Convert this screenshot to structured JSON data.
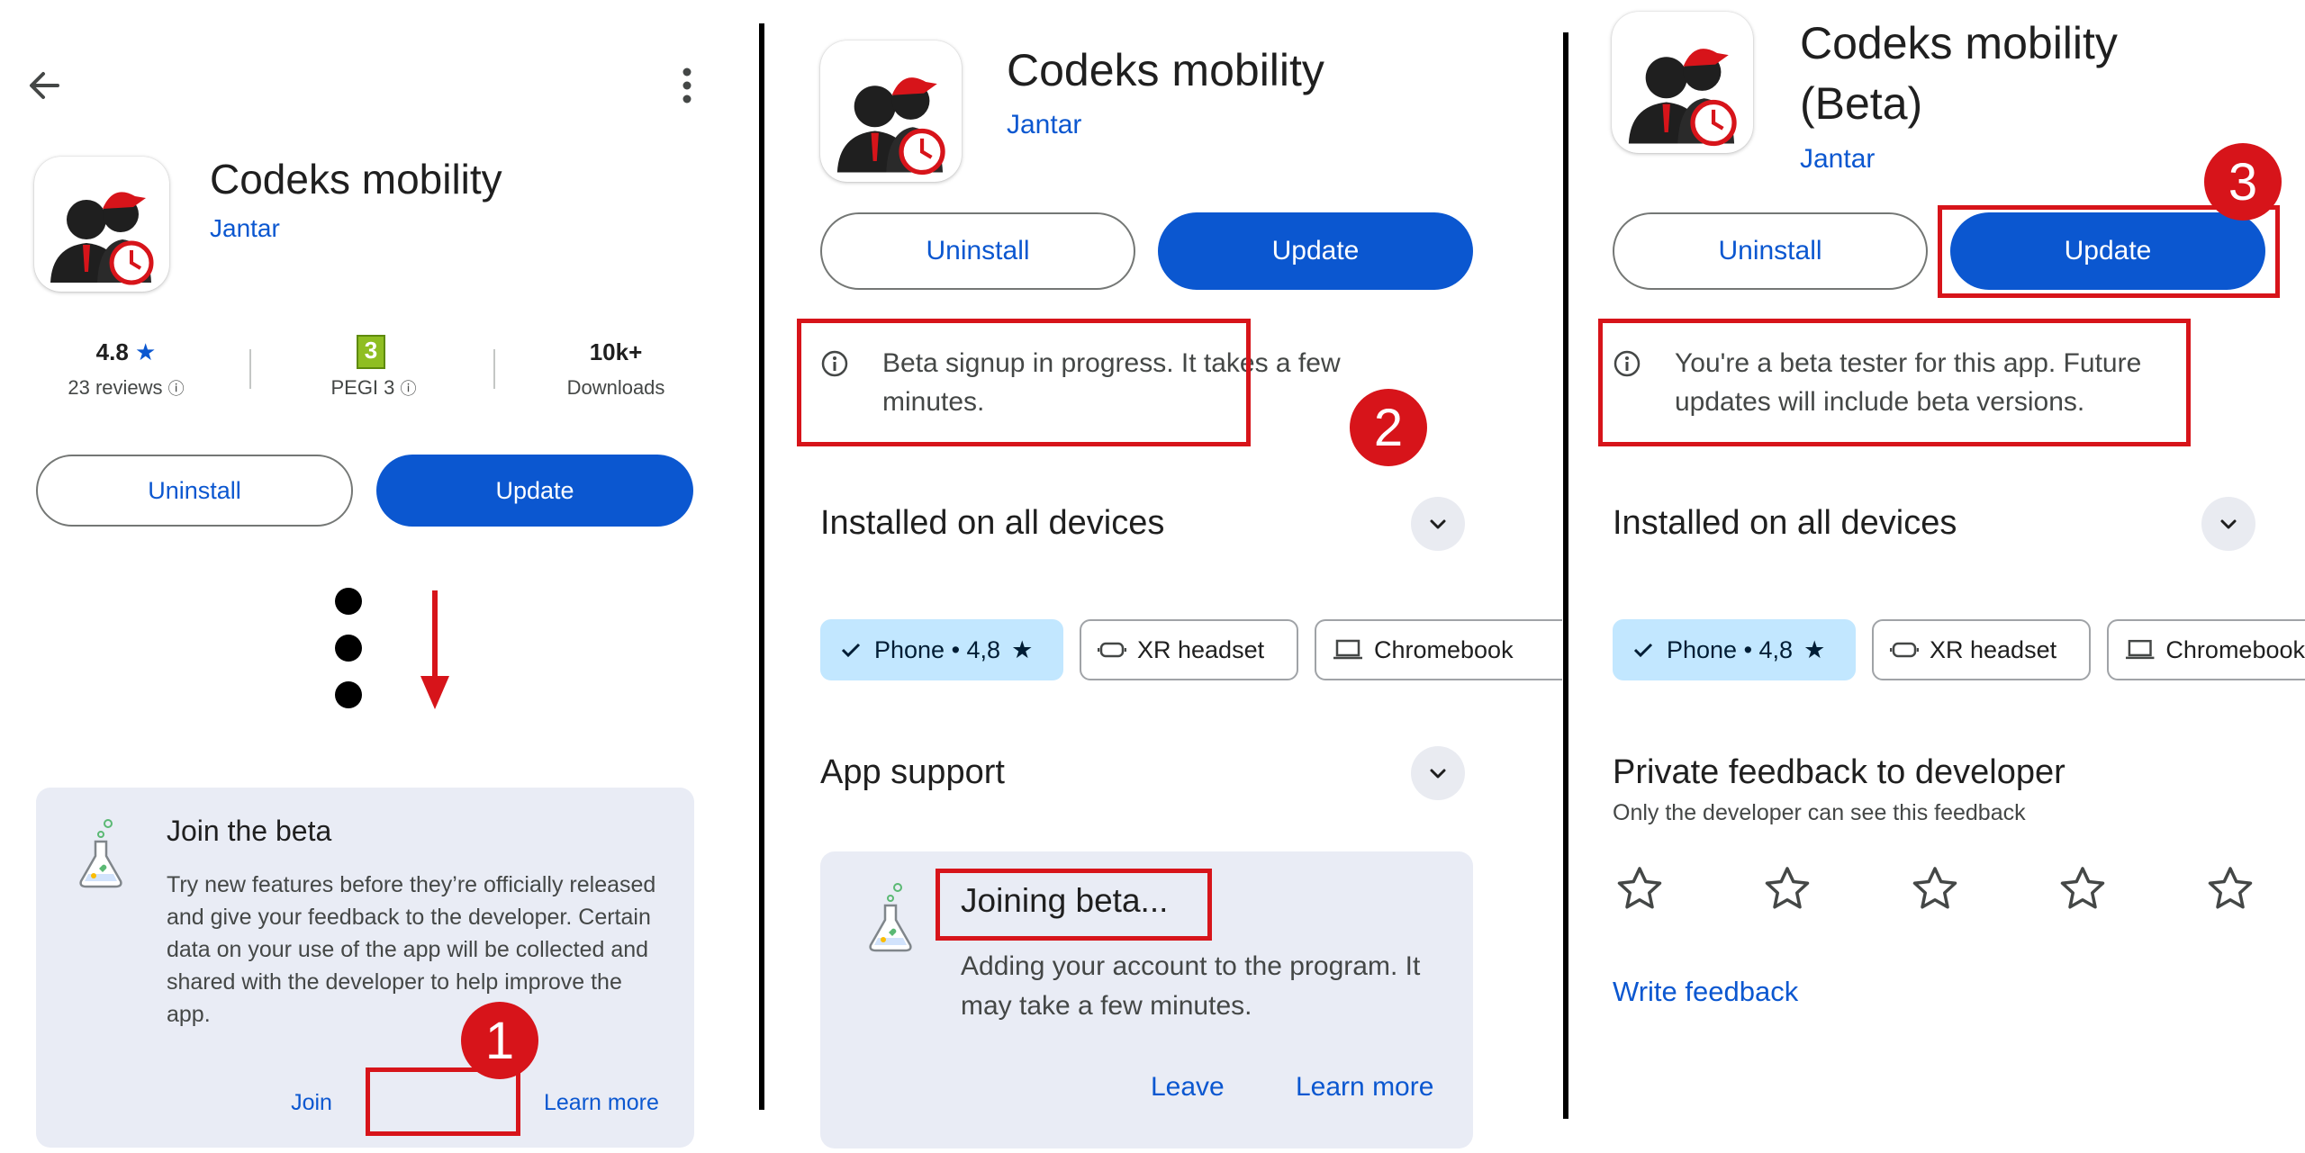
{
  "app": {
    "name": "Codeks mobility",
    "name_beta_line1": "Codeks mobility",
    "name_beta_line2": "(Beta)",
    "developer": "Jantar"
  },
  "meta": {
    "rating": "4.8",
    "reviews": "23 reviews",
    "pegi": "PEGI 3",
    "downloads_value": "10k+",
    "downloads_label": "Downloads"
  },
  "buttons": {
    "uninstall": "Uninstall",
    "update": "Update"
  },
  "beta_card": {
    "title": "Join the beta",
    "body": "Try new features before they’re officially released and give your feedback to the developer. Certain data on your use of the app will be collected and shared with the developer to help improve the app.",
    "join": "Join",
    "learn_more": "Learn more"
  },
  "panel2": {
    "info": "Beta signup in progress. It takes a few minutes.",
    "installed_title": "Installed on all devices",
    "app_support_title": "App support",
    "joining_title": "Joining beta...",
    "joining_body": "Adding your account to the program. It may take a few minutes.",
    "leave": "Leave",
    "learn_more": "Learn more"
  },
  "chips": {
    "phone": "Phone • 4,8",
    "xr": "XR headset",
    "chromebook": "Chromebook"
  },
  "panel3": {
    "info": "You're a beta tester for this app. Future updates will include beta versions.",
    "installed_title": "Installed on all devices",
    "feedback_title": "Private feedback to developer",
    "feedback_sub": "Only the developer can see this feedback",
    "write_feedback": "Write feedback",
    "stars_total": 5
  },
  "steps": [
    "1",
    "2",
    "3"
  ],
  "colors": {
    "accent": "#0b57d0",
    "highlight": "#d7141a",
    "chip_selected": "#c2e7ff",
    "card_bg": "#e9ecf5"
  }
}
